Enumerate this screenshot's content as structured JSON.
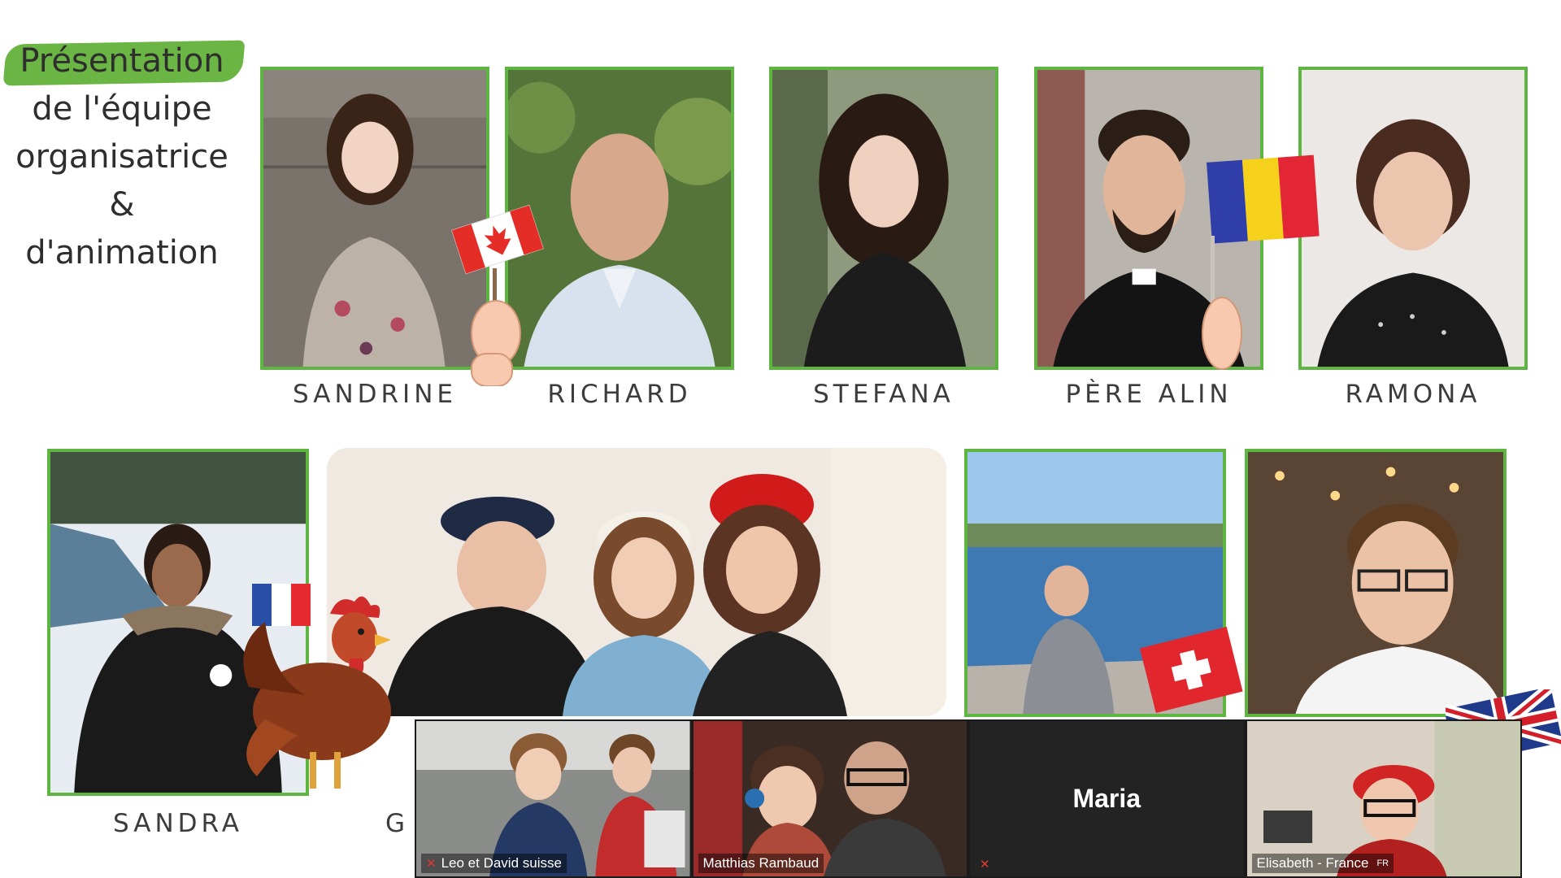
{
  "slide": {
    "title_line1": "Présentation",
    "title_line2": "de l'équipe",
    "title_line3": "organisatrice",
    "title_line4": "&",
    "title_line5": "d'animation"
  },
  "team_top": [
    {
      "name": "SANDRINE",
      "flag": "canada"
    },
    {
      "name": "RICHARD"
    },
    {
      "name": "STEFANA"
    },
    {
      "name": "PÈRE ALIN",
      "flag": "romania"
    },
    {
      "name": "RAMONA"
    }
  ],
  "team_bottom": [
    {
      "name": "SANDRA",
      "flag": "france"
    },
    {
      "name": "G",
      "note": "partially hidden by video strip"
    }
  ],
  "flags": [
    "canada-flag-icon",
    "romania-flag-icon",
    "france-flag-icon",
    "switzerland-flag-icon",
    "uk-flag-icon",
    "rooster-icon"
  ],
  "video_participants": [
    {
      "label": "Leo et David suisse",
      "muted": true
    },
    {
      "label": "Matthias Rambaud",
      "muted": false
    },
    {
      "label": "Maria",
      "muted": true,
      "video_off": true
    },
    {
      "label": "Elisabeth - France",
      "tag": "FR",
      "muted": false
    }
  ],
  "colors": {
    "accent_green": "#5eb542",
    "highlight_green": "#6ab543",
    "strip_bg": "#1b1b1b"
  }
}
